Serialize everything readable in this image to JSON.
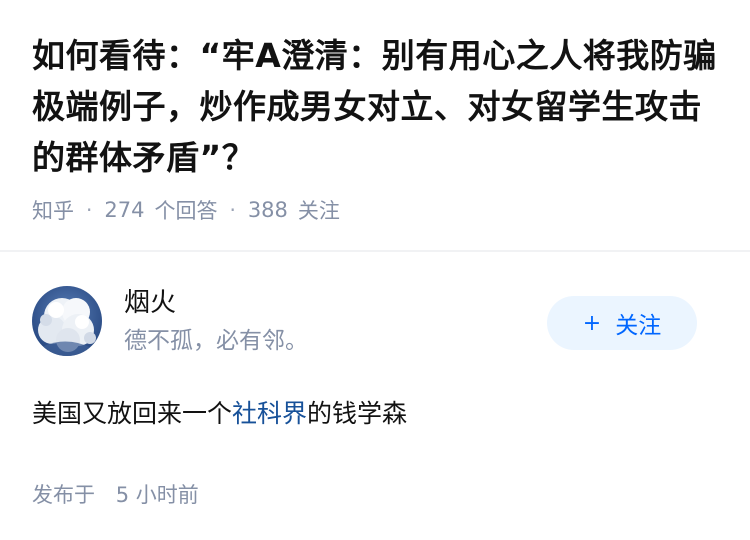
{
  "question": {
    "title": "如何看待：“牢A澄清：别有用心之人将我防骗极端例子，炒作成男女对立、对女留学生攻击的群体矛盾”？",
    "source": "知乎",
    "answer_count": "274",
    "answer_label": "个回答",
    "follower_count": "388",
    "follower_label": "关注"
  },
  "answer": {
    "author": {
      "name": "烟火",
      "bio": "德不孤，必有邻。",
      "avatar_icon": "snow-rime-avatar"
    },
    "follow_button": {
      "icon": "plus-icon",
      "label": "关注"
    },
    "content": {
      "before": "美国又放回来一个",
      "link": "社科界",
      "after": "的钱学森"
    },
    "time": {
      "prefix": "发布于",
      "value": "5",
      "unit": "小时前"
    }
  },
  "colors": {
    "primary_text": "#121212",
    "secondary_text": "#8590a6",
    "accent": "#0066ff",
    "link": "#175199",
    "button_bg": "#ebf5ff"
  }
}
